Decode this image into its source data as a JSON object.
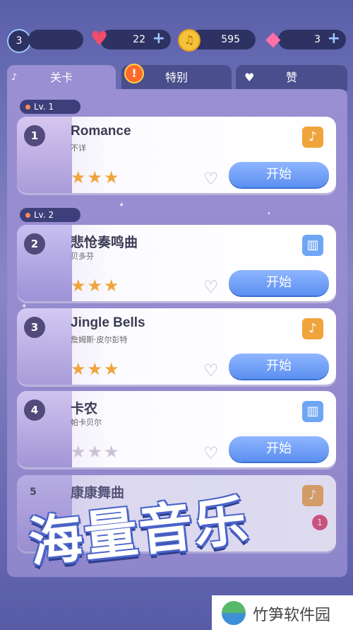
{
  "topbar": {
    "level": "3",
    "hearts": "22",
    "coins": "595",
    "gems": "3",
    "plus": "+"
  },
  "tabs": [
    {
      "label": "关卡"
    },
    {
      "label": "特别"
    },
    {
      "label": "赞"
    }
  ],
  "levels": [
    {
      "label": "Lv. 1"
    },
    {
      "label": "Lv. 2"
    }
  ],
  "songs": [
    {
      "num": "1",
      "title": "Romance",
      "artist": "不详",
      "stars": "★★★",
      "start": "开始",
      "instrument": "guitar"
    },
    {
      "num": "2",
      "title": "悲怆奏鸣曲",
      "artist": "贝多芬",
      "stars": "★★★",
      "start": "开始",
      "instrument": "piano"
    },
    {
      "num": "3",
      "title": "Jingle Bells",
      "artist": "詹姆斯·皮尔彭特",
      "stars": "★★★",
      "start": "开始",
      "instrument": "guitar"
    },
    {
      "num": "4",
      "title": "卡农",
      "artist": "帕卡贝尔",
      "stars": "★★★",
      "start": "开始",
      "instrument": "piano"
    },
    {
      "num": "5",
      "title": "康康舞曲",
      "artist": "",
      "instrument": "guitar"
    }
  ],
  "banner": "海量音乐",
  "watermark": "竹笋软件园",
  "colors": {
    "accent": "#5b8ff0",
    "star": "#f0a43c",
    "guitar": "#f0a43c",
    "piano": "#6fa5f5"
  }
}
